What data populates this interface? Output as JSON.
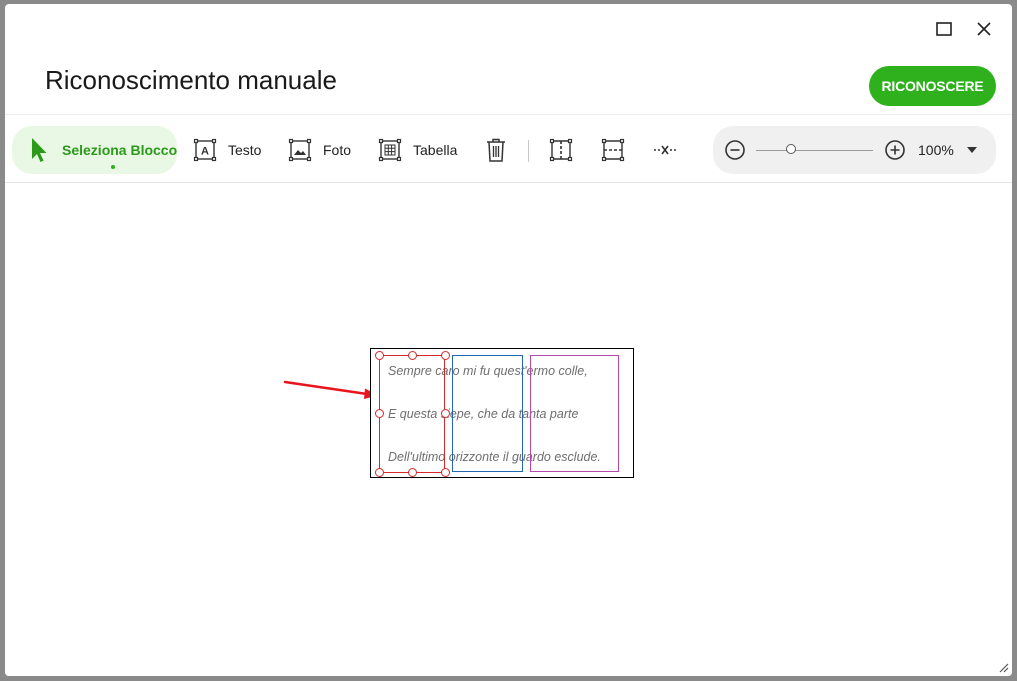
{
  "window": {
    "title": "Riconoscimento manuale",
    "primary_button": "RICONOSCERE",
    "controls": [
      "maximize-icon",
      "close-icon"
    ]
  },
  "toolbar": {
    "tools": [
      {
        "label": "Seleziona Blocco",
        "icon": "cursor-arrow-icon",
        "active": true
      },
      {
        "label": "Testo",
        "icon": "text-block-icon"
      },
      {
        "label": "Foto",
        "icon": "picture-block-icon"
      },
      {
        "label": "Tabella",
        "icon": "table-block-icon"
      }
    ],
    "icon_tools": [
      "delete-icon",
      "split-vertical-icon",
      "split-horizontal-icon",
      "remove-separator-icon"
    ],
    "zoom": {
      "value": "100%",
      "level_fraction": 0.3
    }
  },
  "document": {
    "lines": [
      "Sempre caro mi fu quest'ermo colle,",
      "E questa siepe, che da tanta parte",
      "Dell'ultimo orizzonte il guardo esclude."
    ],
    "blocks": [
      {
        "type": "selected",
        "color": "#d42a2a"
      },
      {
        "type": "text",
        "color": "#2367b0"
      },
      {
        "type": "picture",
        "color": "#b44aae"
      }
    ],
    "annotation_arrow_color": "#e8141e"
  },
  "colors": {
    "accent": "#2eb11c",
    "active_bg": "#e9f8e4"
  }
}
